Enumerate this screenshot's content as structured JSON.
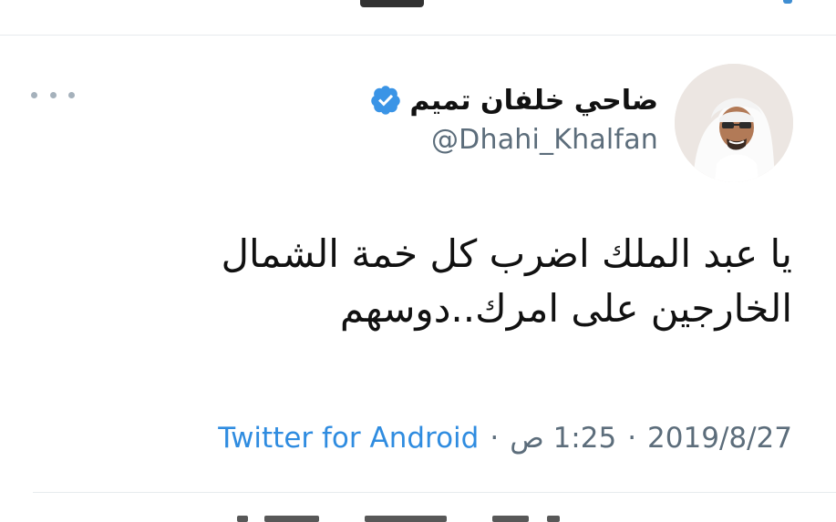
{
  "tweet": {
    "author": {
      "display_name": "ضاحي خلفان تميم",
      "handle": "@Dhahi_Khalfan",
      "verified": true,
      "verified_icon": "verified-badge-icon"
    },
    "more_icon": "more-horizontal-icon",
    "text_lines": [
      "يا عبد الملك اضرب كل خمة الشمال",
      "الخارجين على امرك..دوسهم"
    ],
    "meta": {
      "date": "2019/8/27",
      "time": "1:25 ص",
      "source": "Twitter for Android",
      "separator": "·"
    }
  },
  "colors": {
    "link_blue": "#2f8ce0",
    "badge_blue": "#3a94e6",
    "secondary_text": "#5c6d7b",
    "divider": "#e7ebee",
    "primary_text": "#111111"
  }
}
